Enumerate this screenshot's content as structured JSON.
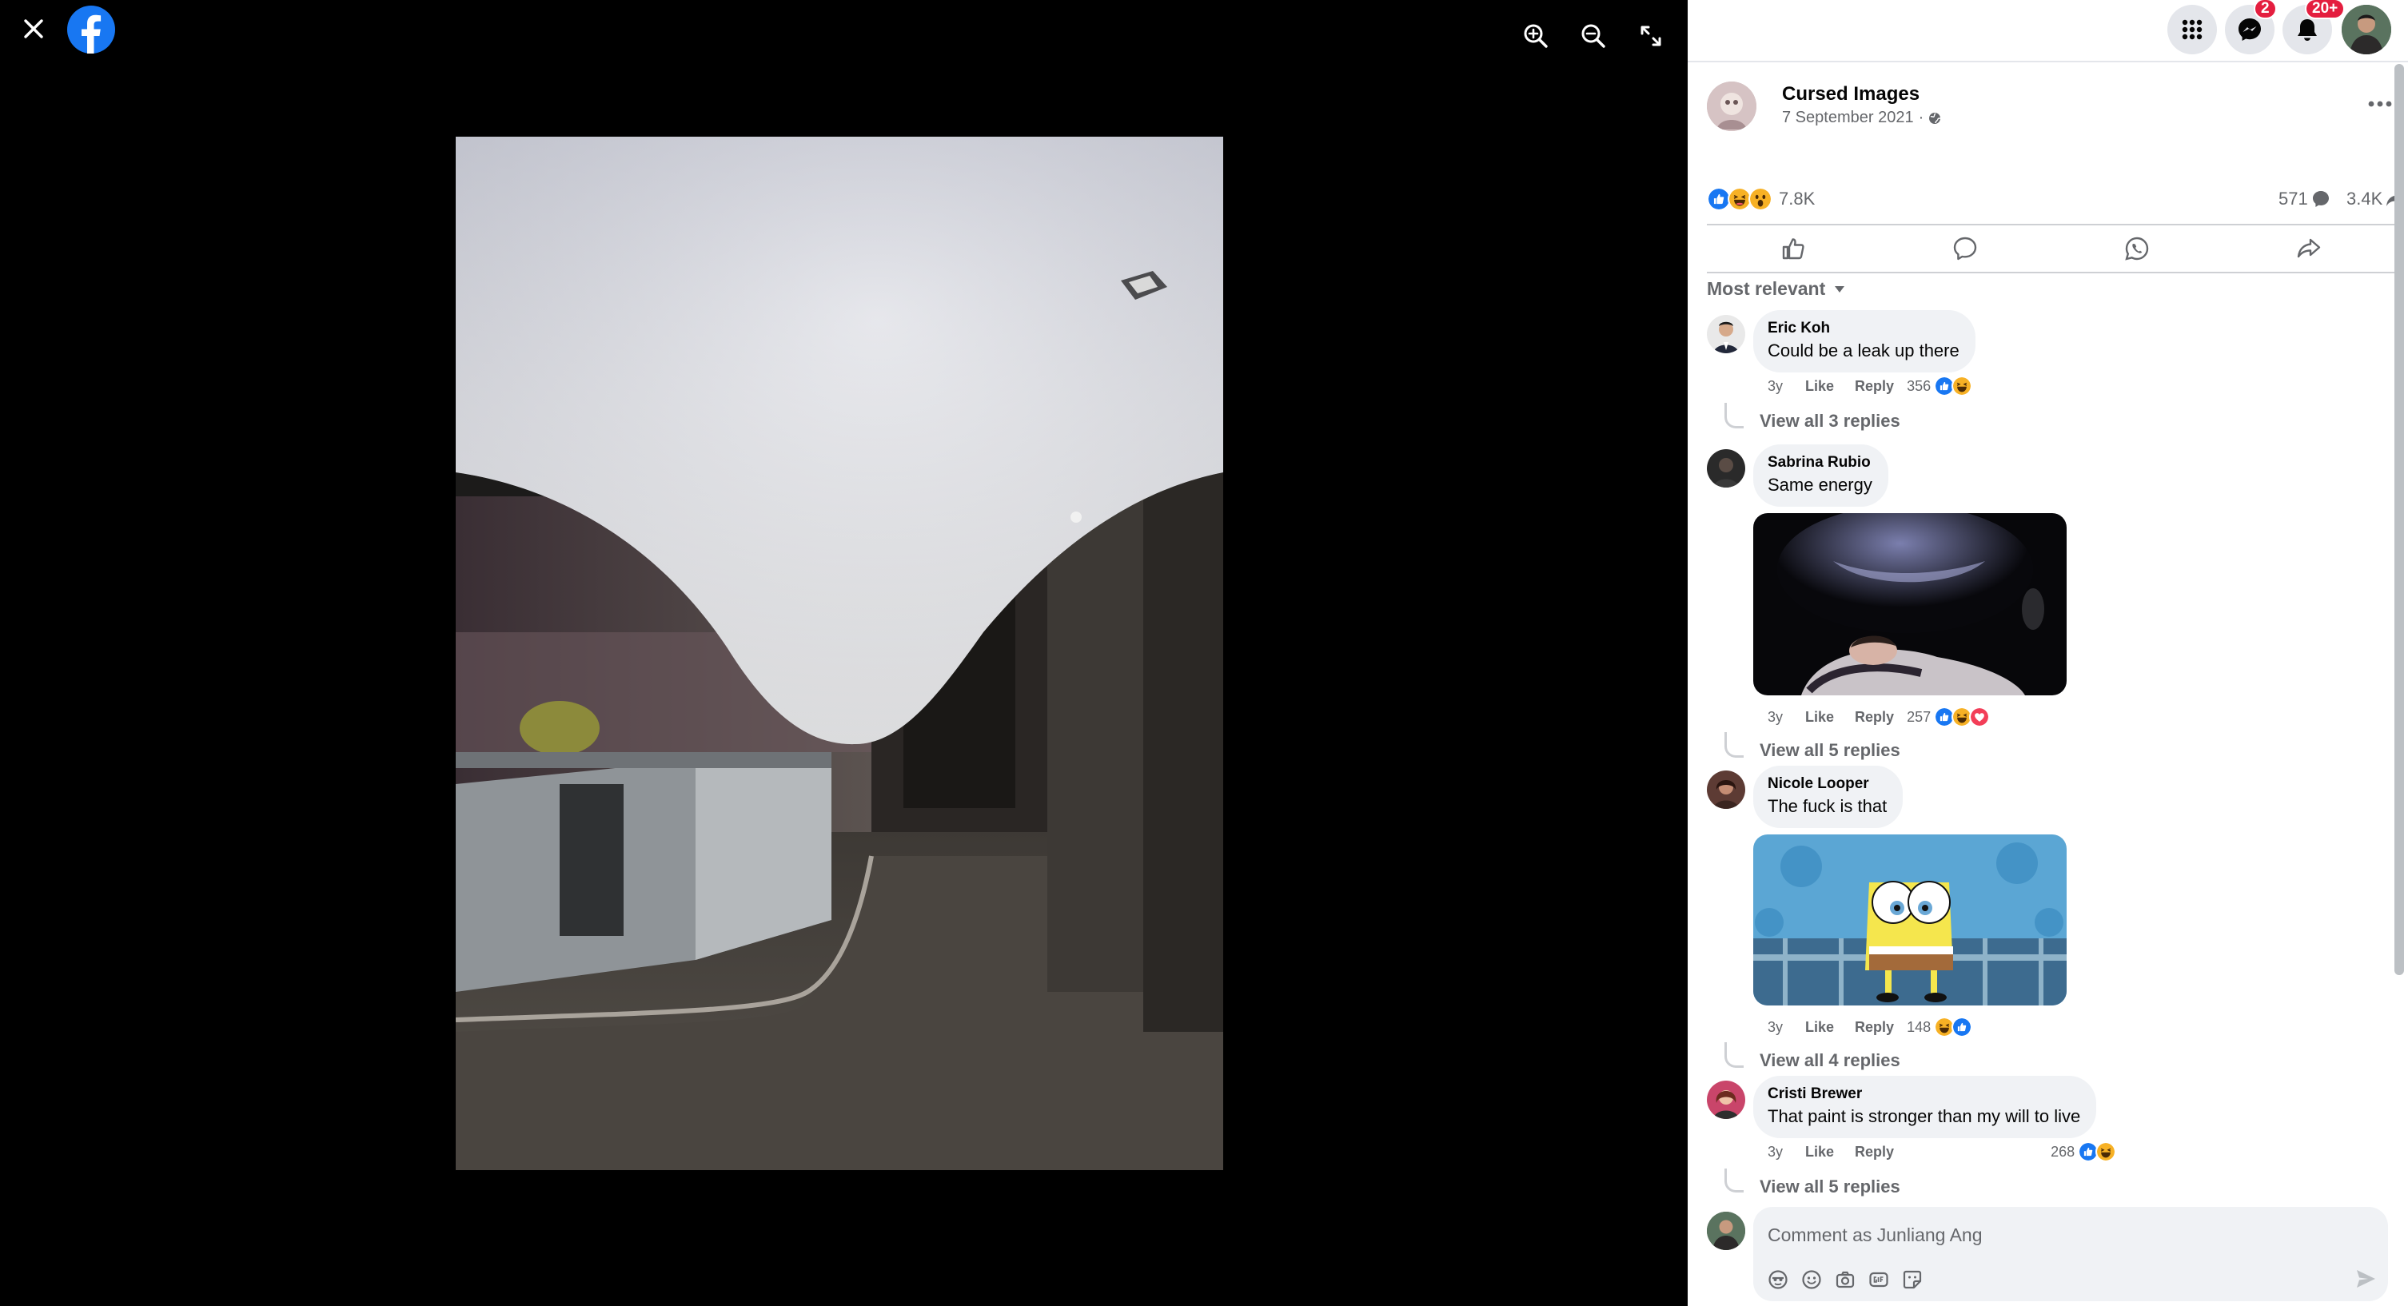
{
  "viewer": {
    "close_icon": "close-icon",
    "logo": "facebook-logo",
    "tools": [
      "zoom-in-icon",
      "zoom-out-icon",
      "fullscreen-icon"
    ]
  },
  "topbar": {
    "menu_icon": "grid-menu-icon",
    "messenger_badge": "2",
    "notifications_badge": "20+"
  },
  "post": {
    "page_name": "Cursed Images",
    "date": "7 September 2021",
    "separator": "·",
    "privacy_icon": "globe-icon",
    "reaction_count": "7.8K",
    "reactions": [
      "like",
      "haha",
      "wow"
    ],
    "comment_count": "571",
    "share_count": "3.4K"
  },
  "actions": [
    "like-icon",
    "comment-icon",
    "whatsapp-icon",
    "share-icon"
  ],
  "sort": {
    "label": "Most relevant"
  },
  "comments": [
    {
      "author": "Eric Koh",
      "text": "Could be a leak up there",
      "time": "3y",
      "like": "Like",
      "reply": "Reply",
      "count": "356",
      "reactions": [
        "like",
        "haha"
      ],
      "view_replies": "View all 3 replies"
    },
    {
      "author": "Sabrina Rubio",
      "text": "Same energy",
      "time": "3y",
      "like": "Like",
      "reply": "Reply",
      "count": "257",
      "reactions": [
        "like",
        "haha",
        "love"
      ],
      "view_replies": "View all 5 replies"
    },
    {
      "author": "Nicole Looper",
      "text": "The fuck is that",
      "time": "3y",
      "like": "Like",
      "reply": "Reply",
      "count": "148",
      "reactions": [
        "haha",
        "like"
      ],
      "view_replies": "View all 4 replies"
    },
    {
      "author": "Cristi Brewer",
      "text": "That paint is stronger than my will to live",
      "time": "3y",
      "like": "Like",
      "reply": "Reply",
      "count": "268",
      "reactions": [
        "like",
        "haha"
      ],
      "view_replies": "View all 5 replies"
    }
  ],
  "composer": {
    "placeholder": "Comment as Junliang Ang",
    "tools": [
      "avatar-sticker-icon",
      "emoji-icon",
      "camera-icon",
      "gif-icon",
      "sticker-icon"
    ],
    "send_icon": "send-icon"
  },
  "colors": {
    "brand": "#1877f2",
    "secondary_text": "#65676b",
    "badge": "#e41e3f",
    "bubble": "#f0f2f5"
  }
}
